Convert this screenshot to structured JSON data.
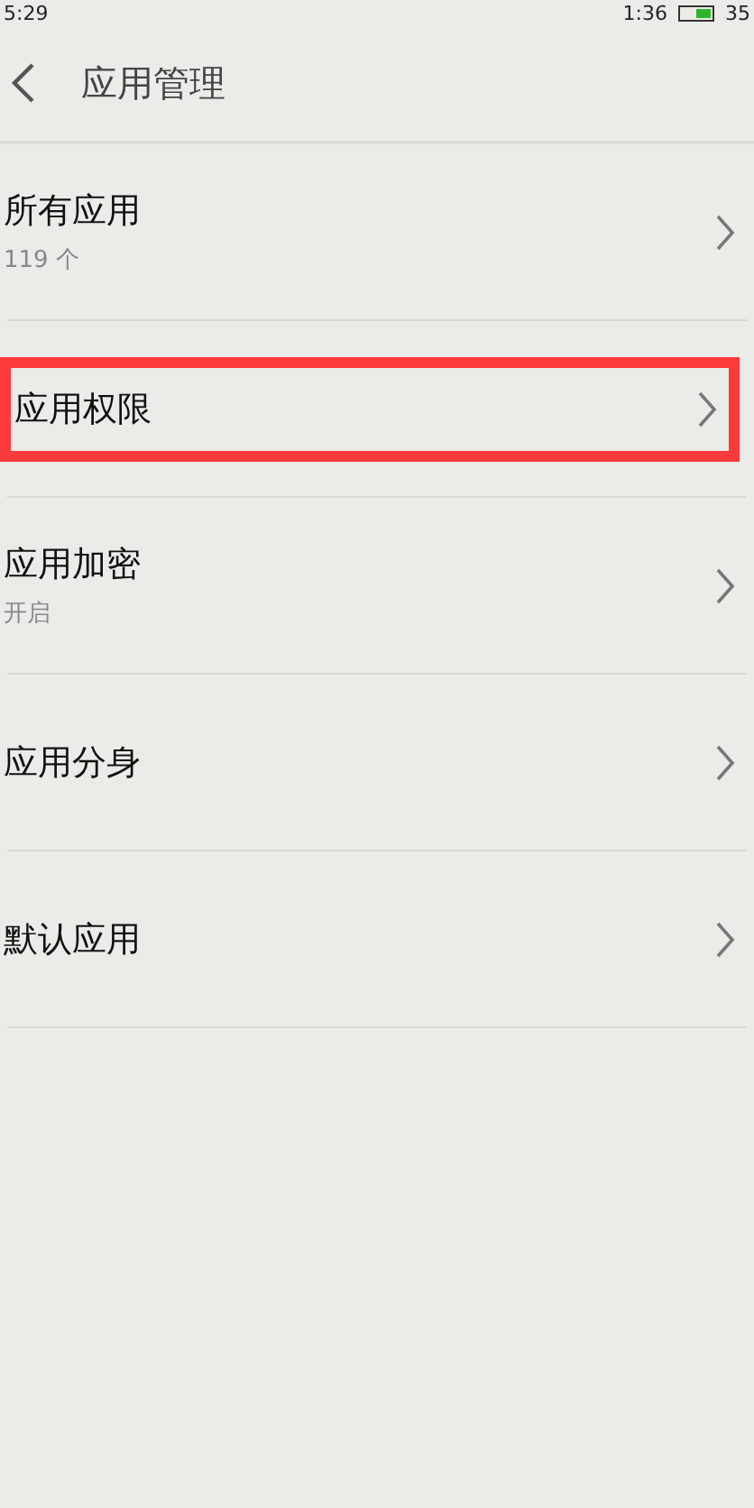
{
  "status_bar": {
    "left": "5:29",
    "time": "1:36",
    "battery": "35"
  },
  "header": {
    "title": "应用管理"
  },
  "items": [
    {
      "label": "所有应用",
      "subtitle": "119 个",
      "highlighted": false
    },
    {
      "label": "应用权限",
      "highlighted": true
    },
    {
      "label": "应用加密",
      "subtitle": "开启",
      "highlighted": false
    },
    {
      "label": "应用分身",
      "highlighted": false
    },
    {
      "label": "默认应用",
      "highlighted": false
    }
  ]
}
